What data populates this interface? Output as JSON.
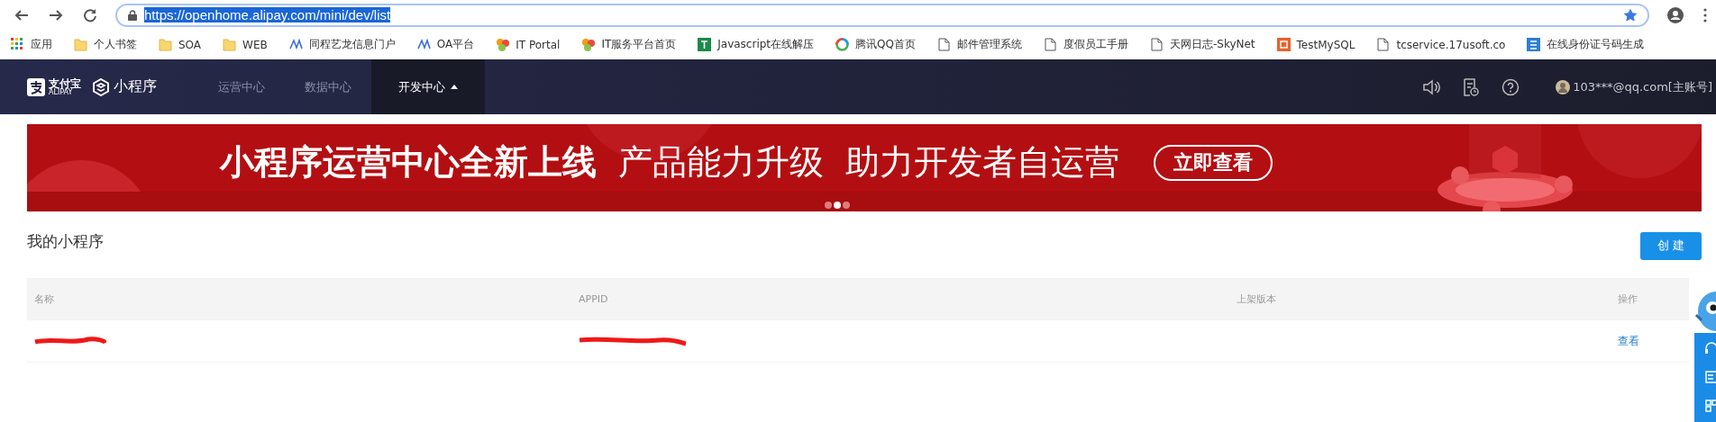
{
  "browser": {
    "url": "https://openhome.alipay.com/mini/dev/list",
    "url_selected": true,
    "bookmarked": true,
    "bookmarks": [
      {
        "label": "应用",
        "kind": "apps"
      },
      {
        "label": "个人书签",
        "kind": "folder"
      },
      {
        "label": "SOA",
        "kind": "folder"
      },
      {
        "label": "WEB",
        "kind": "folder"
      },
      {
        "label": "同程艺龙信息门户",
        "kind": "wave"
      },
      {
        "label": "OA平台",
        "kind": "wave"
      },
      {
        "label": "IT Portal",
        "kind": "flower"
      },
      {
        "label": "IT服务平台首页",
        "kind": "flower"
      },
      {
        "label": "Javascript在线解压",
        "kind": "green"
      },
      {
        "label": "腾讯QQ首页",
        "kind": "ring"
      },
      {
        "label": "邮件管理系统",
        "kind": "page"
      },
      {
        "label": "度假员工手册",
        "kind": "page"
      },
      {
        "label": "天网日志-SkyNet",
        "kind": "page"
      },
      {
        "label": "TestMySQL",
        "kind": "orange"
      },
      {
        "label": "tcservice.17usoft.co",
        "kind": "page"
      },
      {
        "label": "在线身份证号码生成",
        "kind": "blue"
      }
    ]
  },
  "nav": {
    "brand": "支付宝",
    "brand_sub": "ALIPAY",
    "product": "小程序",
    "items": [
      {
        "label": "运营中心",
        "selected": false,
        "dropdown": false
      },
      {
        "label": "数据中心",
        "selected": false,
        "dropdown": false
      },
      {
        "label": "开发中心",
        "selected": true,
        "dropdown": true
      }
    ],
    "account": "103***@qq.com[主账号]"
  },
  "banner": {
    "headline": "小程序运营中心全新上线",
    "subline_1": "产品能力升级",
    "subline_2": "助力开发者自运营",
    "button": "立即查看",
    "dots": [
      {
        "selected": false
      },
      {
        "selected": true
      },
      {
        "selected": false
      }
    ]
  },
  "page": {
    "title": "我的小程序",
    "create_button": "创 建"
  },
  "table": {
    "columns": [
      "名称",
      "APPID",
      "上架版本",
      "操作"
    ],
    "rows": [
      {
        "name_redacted": true,
        "appid_redacted": true,
        "action": "查看"
      }
    ]
  }
}
